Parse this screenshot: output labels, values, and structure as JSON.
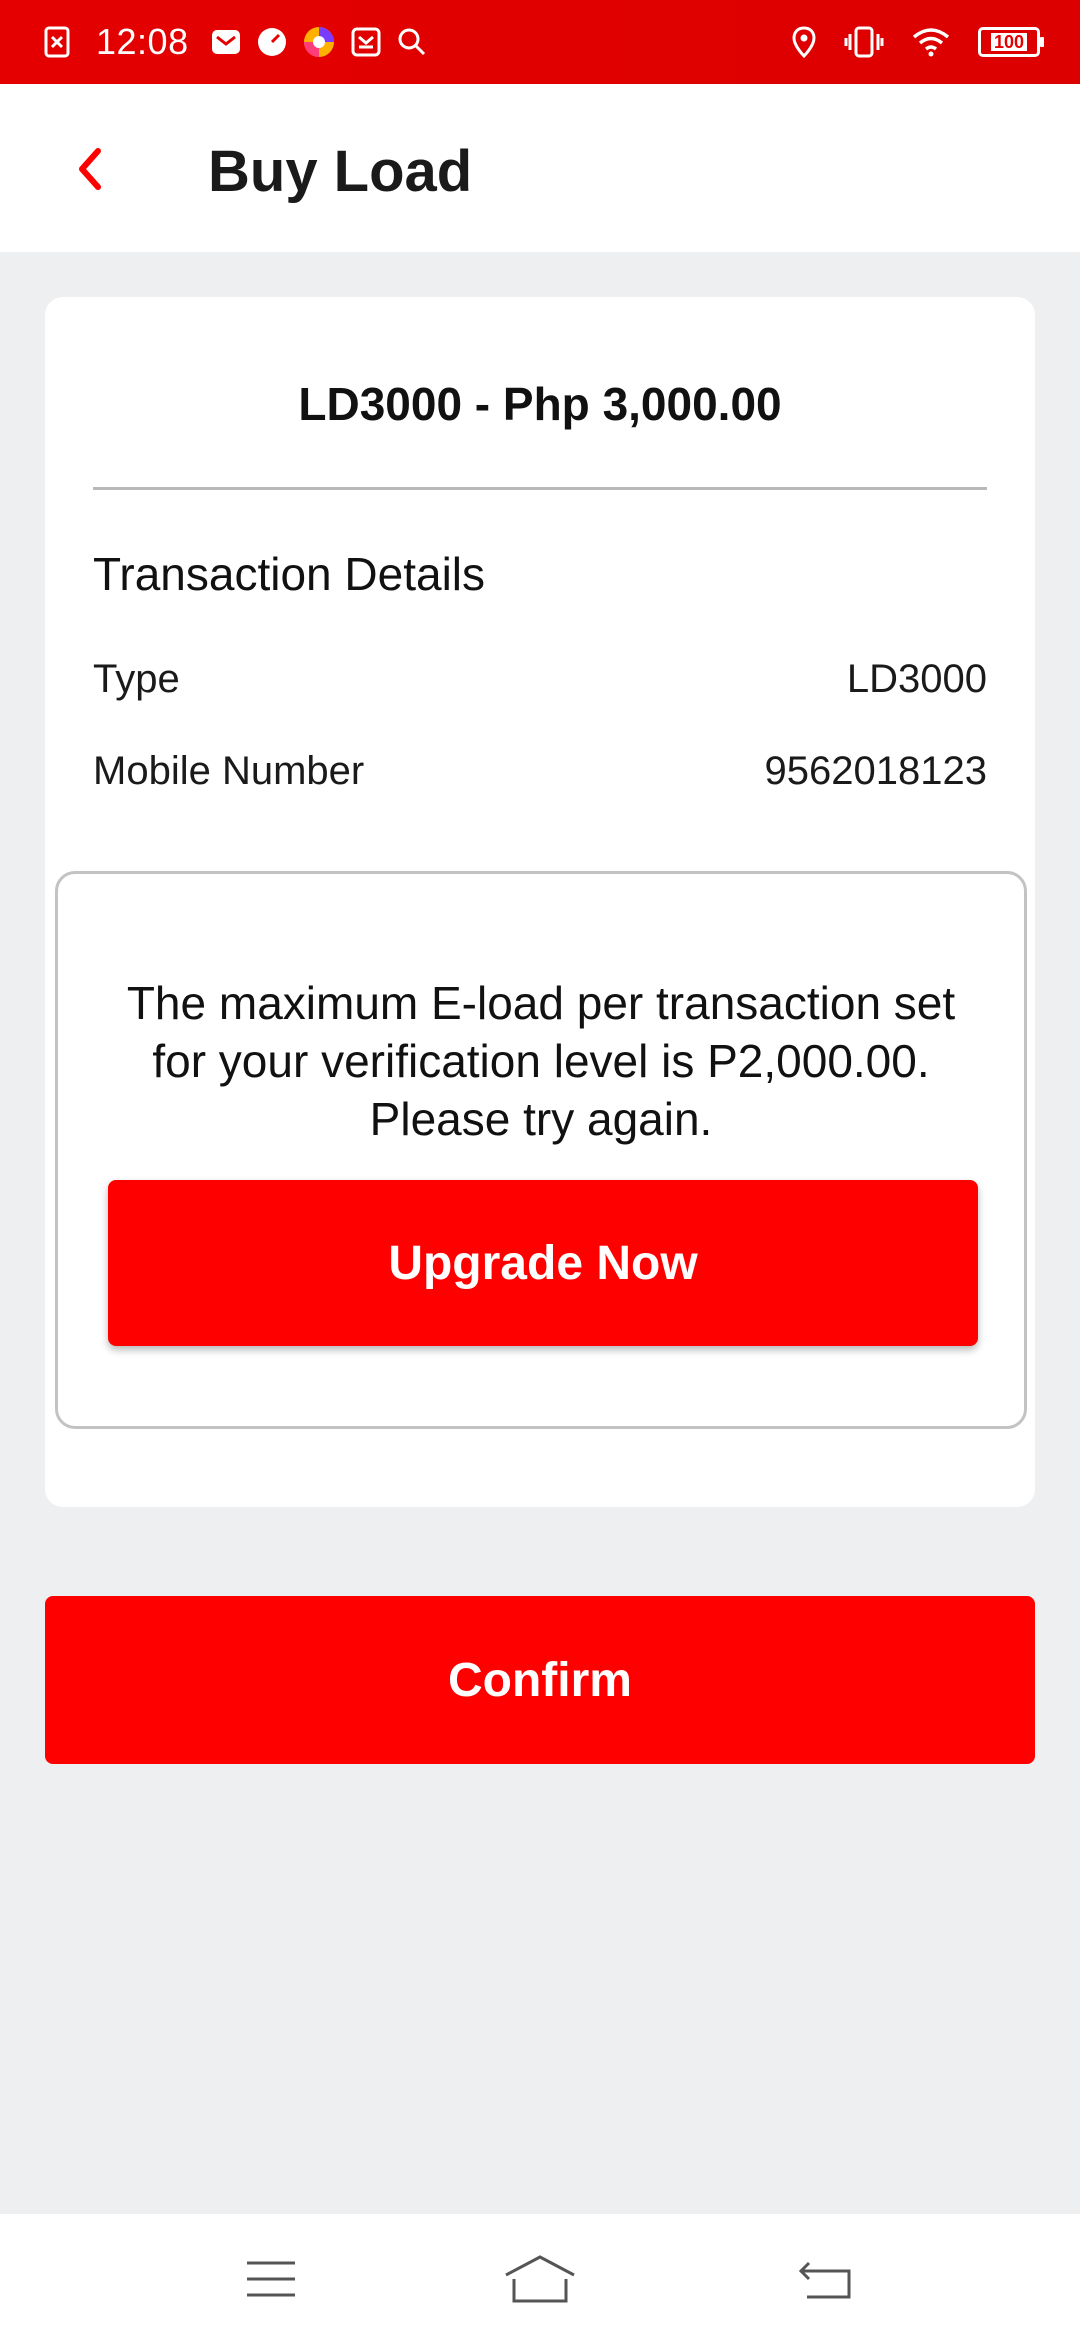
{
  "status_bar": {
    "time": "12:08",
    "battery": "100",
    "icons": [
      "close-box-icon",
      "mail-icon",
      "clock-icon",
      "browser-icon",
      "inbox-icon",
      "search-icon",
      "location-icon",
      "vibrate-icon",
      "wifi-icon",
      "battery-icon"
    ]
  },
  "header": {
    "title": "Buy Load",
    "back_icon": "chevron-left-icon"
  },
  "card": {
    "product_title": "LD3000 - Php 3,000.00",
    "section_title": "Transaction Details",
    "details": [
      {
        "label": "Type",
        "value": "LD3000"
      },
      {
        "label": "Mobile Number",
        "value": "9562018123"
      }
    ],
    "notice": {
      "text": "The maximum E-load per transaction set for your verification level is P2,000.00. Please try again.",
      "button_label": "Upgrade Now"
    }
  },
  "confirm_label": "Confirm",
  "nav": {
    "icons": [
      "menu-icon",
      "home-icon",
      "back-icon"
    ]
  },
  "colors": {
    "brand_red": "#ff0000",
    "status_bar_red": "#e40000",
    "background": "#eeeff1"
  }
}
